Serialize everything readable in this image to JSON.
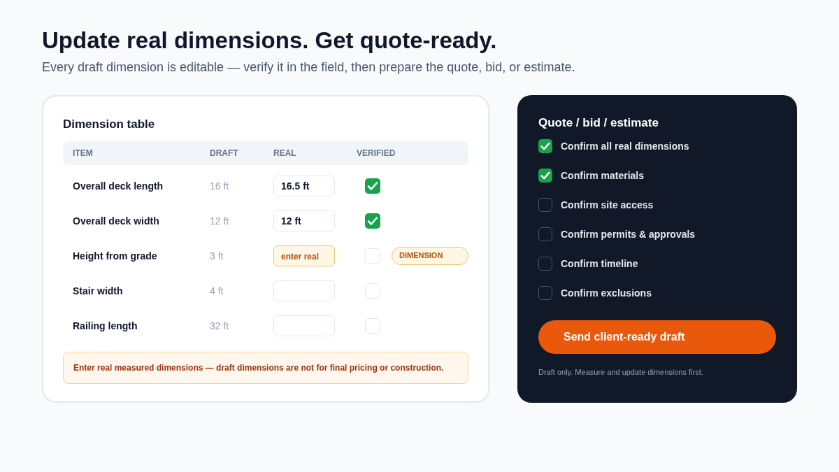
{
  "headline": "Update real dimensions. Get quote-ready.",
  "subtitle": "Every draft dimension is editable — verify it in the field, then prepare the quote, bid, or estimate.",
  "dimension_table": {
    "title": "Dimension table",
    "columns": [
      "ITEM",
      "DRAFT",
      "REAL",
      "VERIFIED"
    ],
    "rows": [
      {
        "item": "Overall deck length",
        "draft": "16 ft",
        "real": "16.5 ft",
        "flagged": false,
        "verified": true
      },
      {
        "item": "Overall deck width",
        "draft": "12 ft",
        "real": "12 ft",
        "flagged": false,
        "verified": true
      },
      {
        "item": "Height from grade",
        "draft": "3 ft",
        "placeholder": "enter real",
        "flagged": true,
        "verified": false,
        "badge": "DIMENSION"
      },
      {
        "item": "Stair width",
        "draft": "4 ft",
        "flagged": false,
        "verified": false
      },
      {
        "item": "Railing length",
        "draft": "32 ft",
        "flagged": false,
        "verified": false
      }
    ],
    "warning": "Enter real measured dimensions — draft dimensions are not for final pricing or construction."
  },
  "quote_panel": {
    "title": "Quote / bid / estimate",
    "checklist": [
      {
        "label": "Confirm all real dimensions",
        "checked": true
      },
      {
        "label": "Confirm materials",
        "checked": true
      },
      {
        "label": "Confirm site access",
        "checked": false
      },
      {
        "label": "Confirm permits & approvals",
        "checked": false
      },
      {
        "label": "Confirm timeline",
        "checked": false
      },
      {
        "label": "Confirm exclusions",
        "checked": false
      }
    ],
    "button": "Send client-ready draft",
    "note": "Draft only. Measure and update dimensions first."
  }
}
